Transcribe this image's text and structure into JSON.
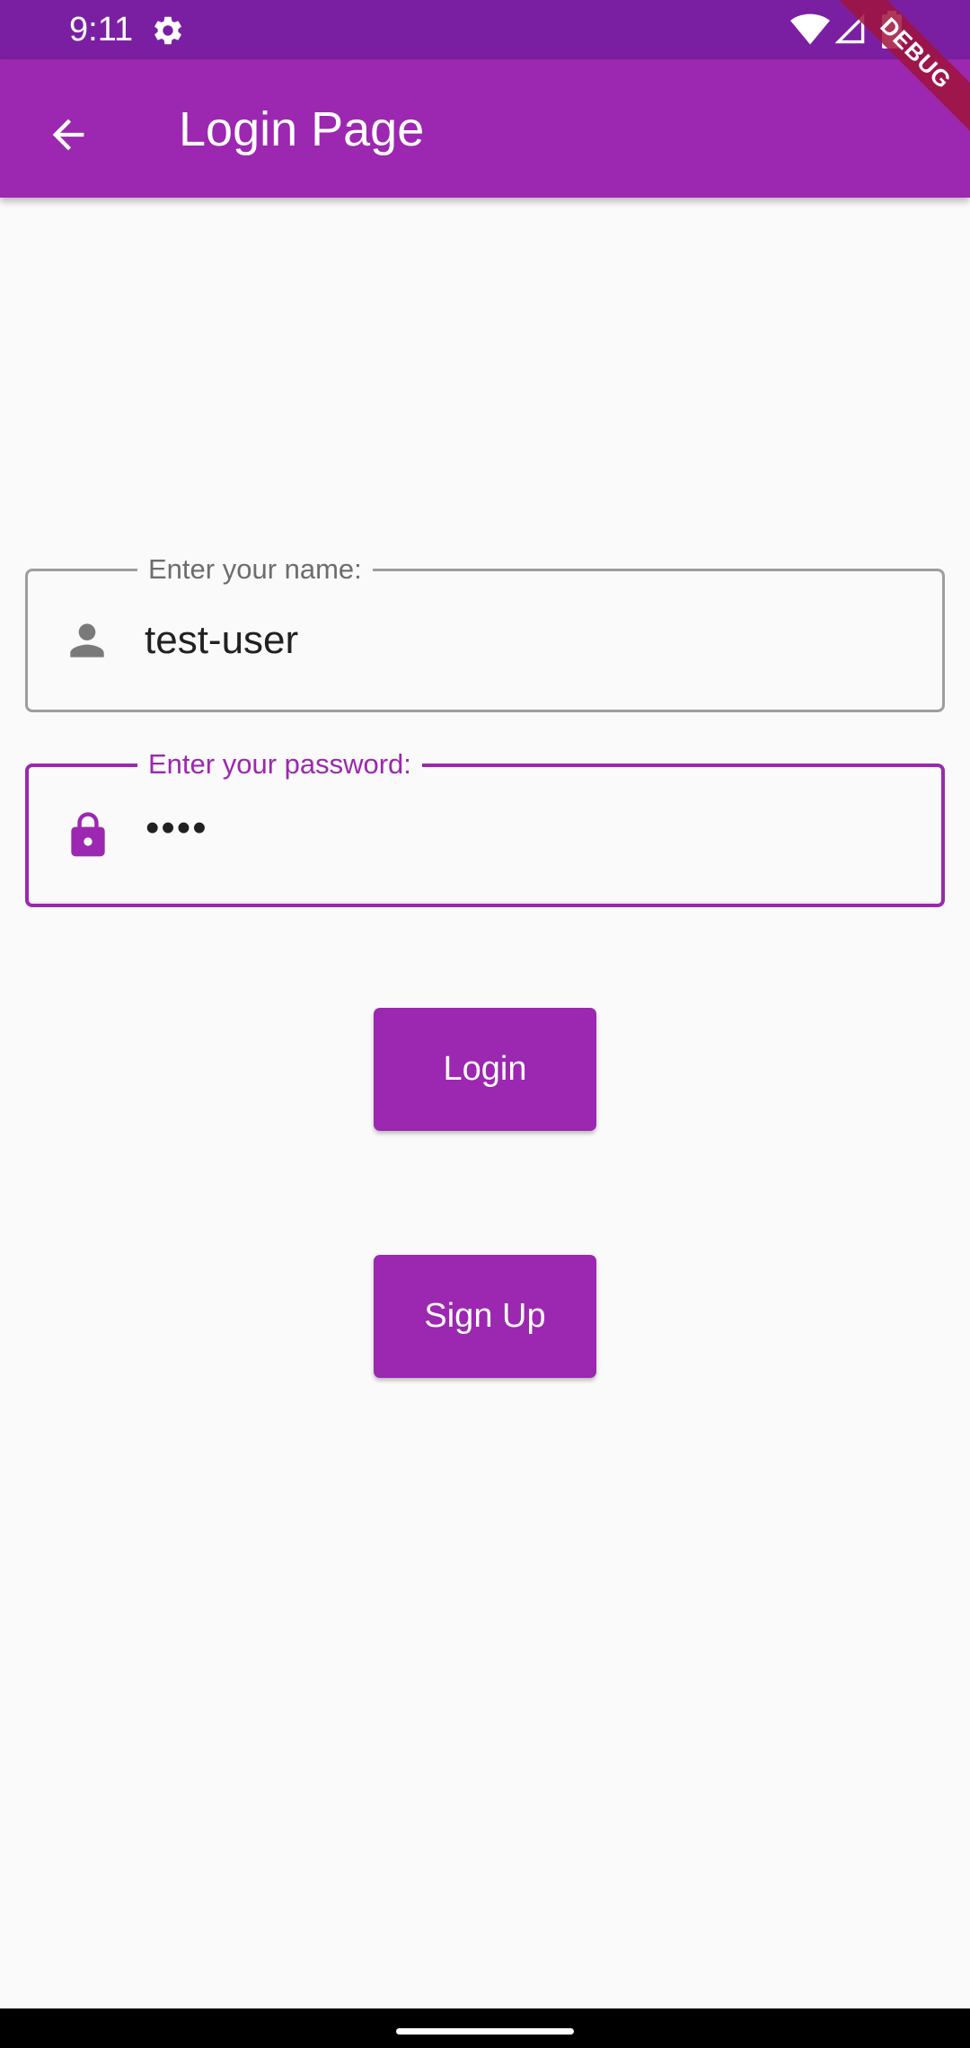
{
  "status_bar": {
    "time": "9:11",
    "icons": [
      "gear-icon",
      "wifi-icon",
      "signal-icon",
      "battery-icon"
    ],
    "background": "#7b1fa2"
  },
  "app_bar": {
    "title": "Login Page",
    "back_icon": "arrow-back-icon",
    "background": "#9c27b0"
  },
  "debug_banner": {
    "label": "DEBUG"
  },
  "form": {
    "name_field": {
      "label": "Enter your name:",
      "value": "test-user",
      "icon": "person-icon"
    },
    "password_field": {
      "label": "Enter your password:",
      "value": "••••",
      "icon": "lock-icon",
      "focused": true
    }
  },
  "buttons": {
    "login_label": "Login",
    "signup_label": "Sign Up"
  },
  "theme": {
    "primary": "#9c27b0",
    "primary_dark": "#7b1fa2",
    "background": "#fafafa"
  }
}
